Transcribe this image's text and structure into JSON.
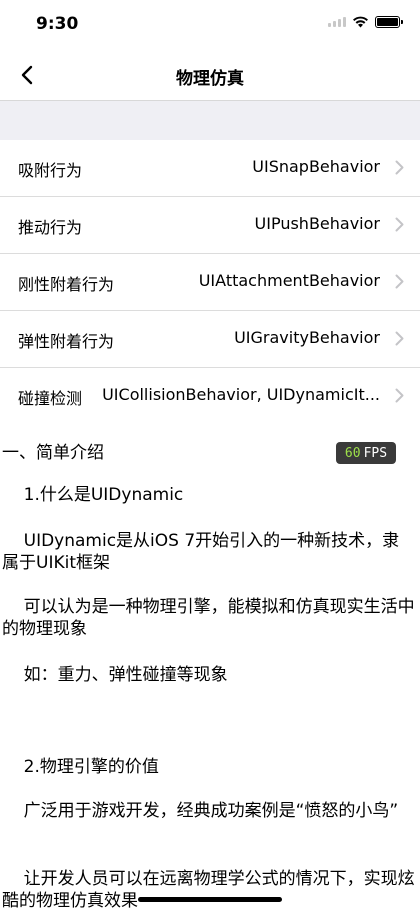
{
  "status_bar": {
    "time": "9:30"
  },
  "nav": {
    "title": "物理仿真"
  },
  "list": [
    {
      "label": "吸附行为",
      "value": "UISnapBehavior"
    },
    {
      "label": "推动行为",
      "value": "UIPushBehavior"
    },
    {
      "label": "刚性附着行为",
      "value": "UIAttachmentBehavior"
    },
    {
      "label": "弹性附着行为",
      "value": "UIGravityBehavior"
    },
    {
      "label": "碰撞检测",
      "value": "UICollisionBehavior, UIDynamicIt..."
    }
  ],
  "content": {
    "heading": "一、简单介绍",
    "fps_number": "60",
    "fps_label": "FPS",
    "p1": "    1.什么是UIDynamic",
    "p2": "    UIDynamic是从iOS 7开始引入的一种新技术，隶属于UIKit框架",
    "p3": "    可以认为是一种物理引擎，能模拟和仿真现实生活中的物理现象",
    "p4": "    如：重力、弹性碰撞等现象",
    "p5": "    2.物理引擎的价值",
    "p6": "    广泛用于游戏开发，经典成功案例是“愤怒的小鸟”",
    "p7": "    让开发人员可以在远离物理学公式的情况下，实现炫酷的物理仿真效果"
  }
}
